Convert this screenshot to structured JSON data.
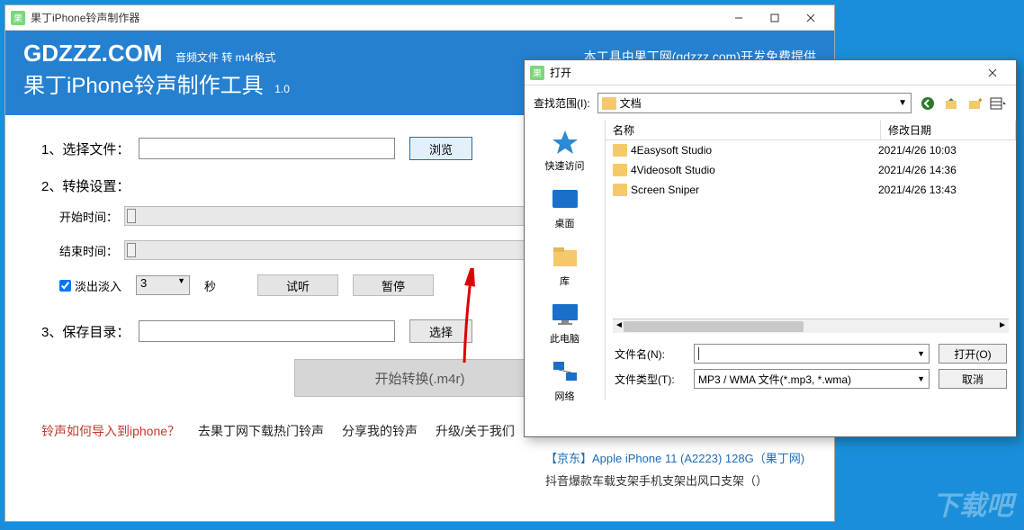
{
  "main": {
    "titlebar": "果丁iPhone铃声制作器",
    "logo": "GDZZZ.COM",
    "logo_sub": "音频文件 转 m4r格式",
    "credit": "本工具由果丁网(gdzzz.com)开发免费提供",
    "app_title": "果丁iPhone铃声制作工具",
    "version": "1.0",
    "step1_label": "1、选择文件：",
    "browse_btn": "浏览",
    "step2_label": "2、转换设置：",
    "start_time": "开始时间：",
    "end_time": "结束时间：",
    "fade_chk": "淡出淡入",
    "fade_val": "3",
    "seconds": "秒",
    "preview_btn": "试听",
    "pause_btn": "暂停",
    "step3_label": "3、保存目录：",
    "select_btn": "选择",
    "convert_btn": "开始转换(.m4r)",
    "footer_links": {
      "l1": "铃声如何导入到iphone？",
      "l2": "去果丁网下载热门铃声",
      "l3": "分享我的铃声",
      "l4": "升级/关于我们"
    },
    "ext_text1": "【京东】Apple iPhone 11 (A2223) 128G（果丁网)",
    "ext_text2": "抖音爆款车载支架手机支架出风口支架（）"
  },
  "dialog": {
    "title": "打开",
    "look_label": "查找范围(I):",
    "look_value": "文档",
    "col_name": "名称",
    "col_date": "修改日期",
    "places": {
      "quick": "快速访问",
      "desktop": "桌面",
      "library": "库",
      "computer": "此电脑",
      "network": "网络"
    },
    "files": [
      {
        "name": "4Easysoft Studio",
        "date": "2021/4/26 10:03"
      },
      {
        "name": "4Videosoft Studio",
        "date": "2021/4/26 14:36"
      },
      {
        "name": "Screen Sniper",
        "date": "2021/4/26 13:43"
      }
    ],
    "filename_label": "文件名(N):",
    "filename_value": "",
    "filetype_label": "文件类型(T):",
    "filetype_value": "MP3 / WMA 文件(*.mp3, *.wma)",
    "open_btn": "打开(O)",
    "cancel_btn": "取消"
  },
  "watermark": "下载吧"
}
